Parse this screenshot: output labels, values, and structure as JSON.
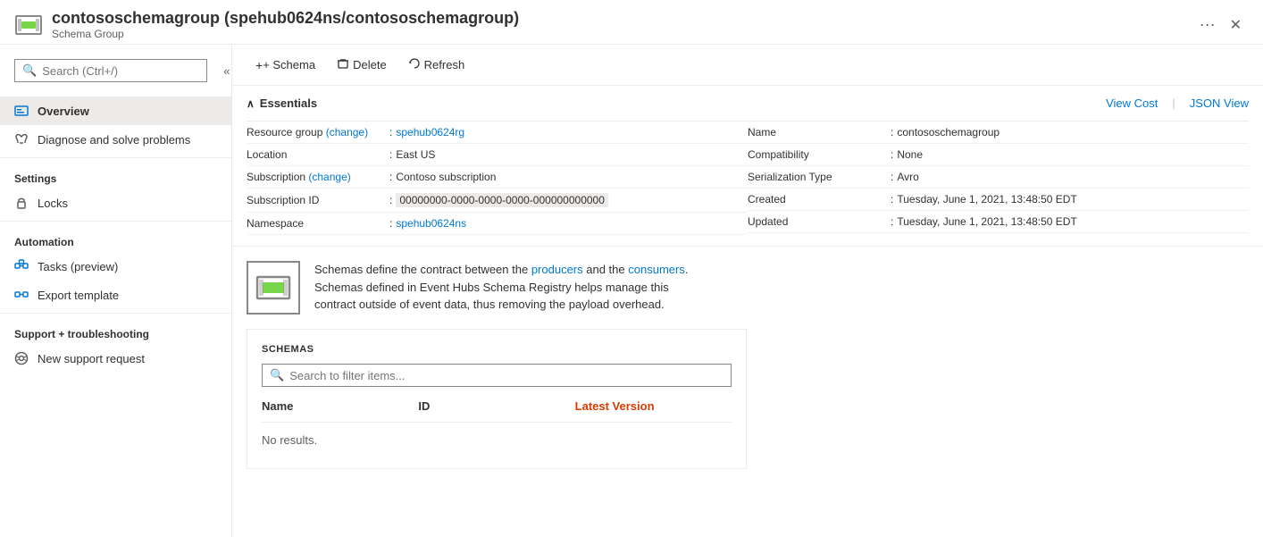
{
  "header": {
    "title": "contososchemagroup (spehub0624ns/contososchemagroup)",
    "subtitle": "Schema Group",
    "ellipsis": "···",
    "close": "✕"
  },
  "sidebar": {
    "search_placeholder": "Search (Ctrl+/)",
    "collapse_label": "«",
    "nav_items": [
      {
        "id": "overview",
        "label": "Overview",
        "active": true,
        "icon": "overview-icon"
      },
      {
        "id": "diagnose",
        "label": "Diagnose and solve problems",
        "active": false,
        "icon": "diagnose-icon"
      }
    ],
    "sections": [
      {
        "label": "Settings",
        "items": [
          {
            "id": "locks",
            "label": "Locks",
            "icon": "lock-icon"
          }
        ]
      },
      {
        "label": "Automation",
        "items": [
          {
            "id": "tasks",
            "label": "Tasks (preview)",
            "icon": "tasks-icon"
          },
          {
            "id": "export",
            "label": "Export template",
            "icon": "export-icon"
          }
        ]
      },
      {
        "label": "Support + troubleshooting",
        "items": [
          {
            "id": "support",
            "label": "New support request",
            "icon": "support-icon"
          }
        ]
      }
    ]
  },
  "toolbar": {
    "schema_label": "+ Schema",
    "delete_label": "Delete",
    "refresh_label": "Refresh"
  },
  "essentials": {
    "title": "Essentials",
    "view_cost_label": "View Cost",
    "json_view_label": "JSON View",
    "left_rows": [
      {
        "label": "Resource group (change)",
        "value": "spehub0624rg",
        "is_link": true
      },
      {
        "label": "Location",
        "value": "East US",
        "is_link": false
      },
      {
        "label": "Subscription (change)",
        "value": "Contoso subscription",
        "is_link": false
      },
      {
        "label": "Subscription ID",
        "value": "00000000-0000-0000-0000-000000000000",
        "is_link": false
      },
      {
        "label": "Namespace",
        "value": "spehub0624ns",
        "is_link": true
      }
    ],
    "right_rows": [
      {
        "label": "Name",
        "value": "contososchemagroup",
        "is_link": false
      },
      {
        "label": "Compatibility",
        "value": "None",
        "is_link": false
      },
      {
        "label": "Serialization Type",
        "value": "Avro",
        "is_link": false
      },
      {
        "label": "Created",
        "value": "Tuesday, June 1, 2021, 13:48:50 EDT",
        "is_link": false
      },
      {
        "label": "Updated",
        "value": "Tuesday, June 1, 2021, 13:48:50 EDT",
        "is_link": false
      }
    ]
  },
  "description": {
    "text_parts": [
      "Schemas define the contract between the ",
      "producers",
      " and the ",
      "consumers",
      ".\nSchemas defined in Event Hubs Schema Registry helps manage this\ncontract outside of event data, thus removing the payload overhead."
    ]
  },
  "schemas": {
    "title": "SCHEMAS",
    "search_placeholder": "Search to filter items...",
    "columns": [
      {
        "label": "Name",
        "is_bold": false
      },
      {
        "label": "ID",
        "is_bold": false
      },
      {
        "label": "Latest Version",
        "is_bold": true
      }
    ],
    "no_results": "No results."
  }
}
